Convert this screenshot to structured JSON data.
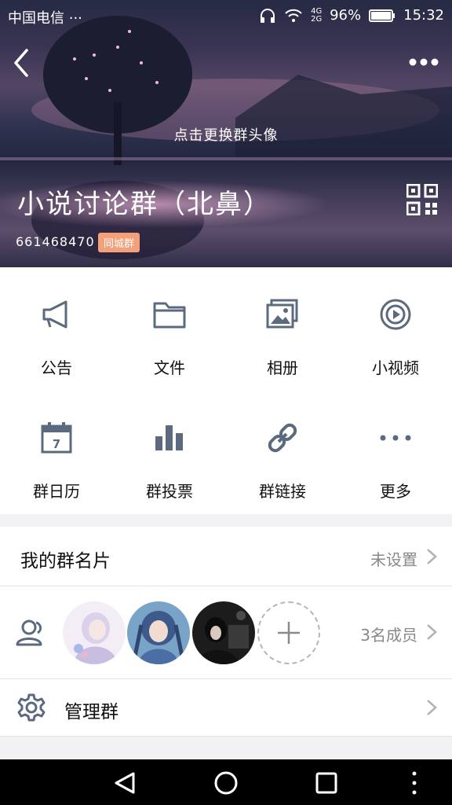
{
  "status_bar": {
    "carrier": "中国电信 ···",
    "network": "4G 2G",
    "battery_percent": "96%",
    "time": "15:32"
  },
  "header": {
    "change_avatar_hint": "点击更换群头像",
    "group_name": "小说讨论群（北鼻）",
    "group_id": "661468470",
    "tag": "同城群"
  },
  "grid": [
    {
      "label": "公告",
      "icon": "megaphone-icon"
    },
    {
      "label": "文件",
      "icon": "folder-icon"
    },
    {
      "label": "相册",
      "icon": "photo-album-icon"
    },
    {
      "label": "小视频",
      "icon": "video-play-icon"
    },
    {
      "label": "群日历",
      "icon": "calendar-icon"
    },
    {
      "label": "群投票",
      "icon": "bar-chart-icon"
    },
    {
      "label": "群链接",
      "icon": "link-icon"
    },
    {
      "label": "更多",
      "icon": "more-dots-icon"
    }
  ],
  "group_card": {
    "title": "我的群名片",
    "value": "未设置"
  },
  "members": {
    "count_label": "3名成员"
  },
  "manage": {
    "title": "管理群"
  },
  "colors": {
    "accent_icon": "#5c6a80",
    "tag_bg": "#f4a07a"
  }
}
